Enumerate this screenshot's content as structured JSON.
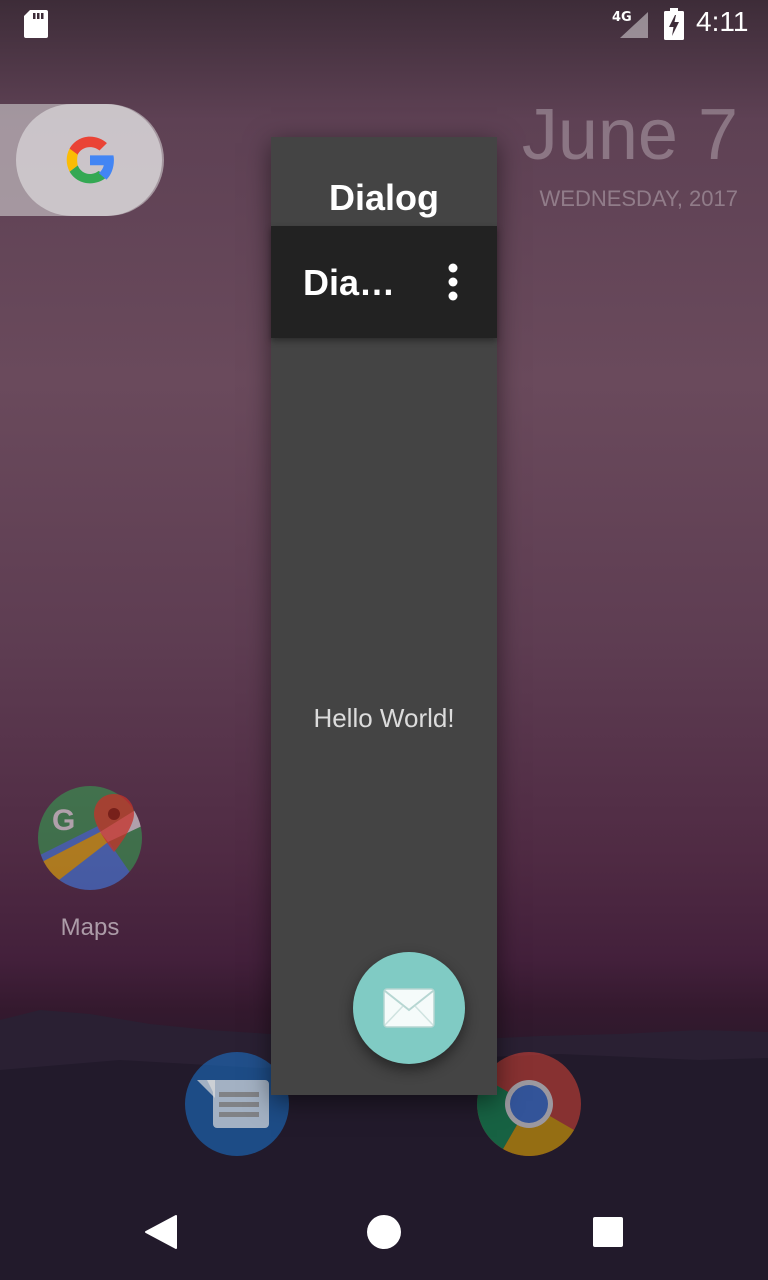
{
  "status_bar": {
    "network": "4G",
    "time": "4:11"
  },
  "widget": {
    "date": "June 7",
    "day": "WEDNESDAY, 2017"
  },
  "apps": {
    "maps_label": "Maps"
  },
  "dialog": {
    "title": "Dialog",
    "toolbar_title": "Dialog",
    "body_text": "Hello World!"
  },
  "colors": {
    "fab": "#80cbc4",
    "dialog_bg": "#444444",
    "toolbar_bg": "#222222"
  },
  "icons": {
    "fab": "mail-icon",
    "overflow": "more-vert-icon",
    "nav": [
      "back-icon",
      "home-icon",
      "recents-icon"
    ]
  }
}
